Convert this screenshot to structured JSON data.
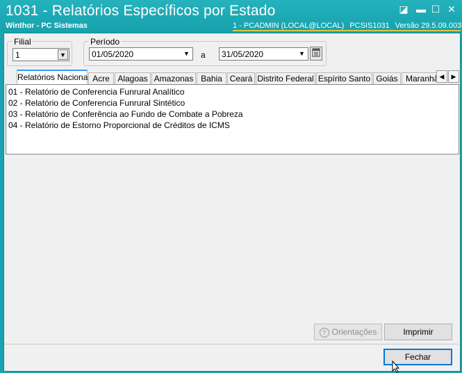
{
  "window": {
    "title": "1031 - Relatórios Específicos por Estado",
    "subtitle": "Winthor - PC Sistemas",
    "status": {
      "user": "1 - PCADMIN (LOCAL@LOCAL)",
      "routine": "PCSIS1031",
      "version": "Versão  29.5.09.003"
    },
    "minimize_glyph": "▬",
    "restore_glyph": "◪",
    "maximize_glyph": "☐",
    "close_glyph": "✕"
  },
  "filial": {
    "label": "Filial",
    "value": "1"
  },
  "periodo": {
    "label": "Período",
    "start": "01/05/2020",
    "separator": "a",
    "end": "31/05/2020"
  },
  "tabs": [
    {
      "label": "Relatórios Nacionais",
      "active": true
    },
    {
      "label": "Acre"
    },
    {
      "label": "Alagoas"
    },
    {
      "label": "Amazonas"
    },
    {
      "label": "Bahia"
    },
    {
      "label": "Ceará"
    },
    {
      "label": "Distrito Federal"
    },
    {
      "label": "Espírito Santo"
    },
    {
      "label": "Goiás"
    },
    {
      "label": "Maranhão"
    }
  ],
  "reports": [
    "01 - Relatório de Conferencia Funrural Analítico",
    "02 - Relatório de Conferencia Funrural Sintético",
    "03 - Relatório de Conferência ao Fundo de Combate a Pobreza",
    "04 - Relatório de Estorno Proporcional de Créditos de ICMS"
  ],
  "buttons": {
    "orientacoes": "Orientações",
    "imprimir": "Imprimir",
    "fechar": "Fechar"
  },
  "icons": {
    "dropdown": "chevron-down-icon",
    "calendar": "calendar-icon",
    "help": "help-icon",
    "tab_prev": "arrow-left-icon",
    "tab_next": "arrow-right-icon"
  }
}
